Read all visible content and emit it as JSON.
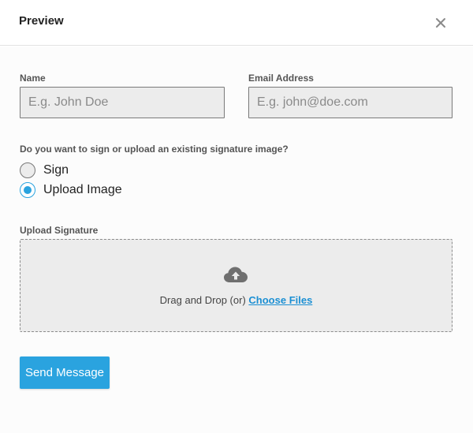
{
  "modal": {
    "title": "Preview",
    "close_icon": "close-icon"
  },
  "form": {
    "name": {
      "label": "Name",
      "value": "",
      "placeholder": "E.g. John Doe"
    },
    "email": {
      "label": "Email Address",
      "value": "",
      "placeholder": "E.g. john@doe.com"
    },
    "signature_choice": {
      "question": "Do you want to sign or upload an existing signature image?",
      "options": [
        {
          "label": "Sign",
          "selected": false
        },
        {
          "label": "Upload Image",
          "selected": true
        }
      ]
    },
    "upload": {
      "label": "Upload Signature",
      "icon": "cloud-upload-icon",
      "drop_text": "Drag and Drop (or)",
      "choose_link": "Choose Files"
    },
    "submit_label": "Send Message"
  },
  "colors": {
    "accent": "#2aa3df",
    "link": "#1b8fd3",
    "input_bg": "#ececec",
    "border": "#7a7a7a"
  }
}
